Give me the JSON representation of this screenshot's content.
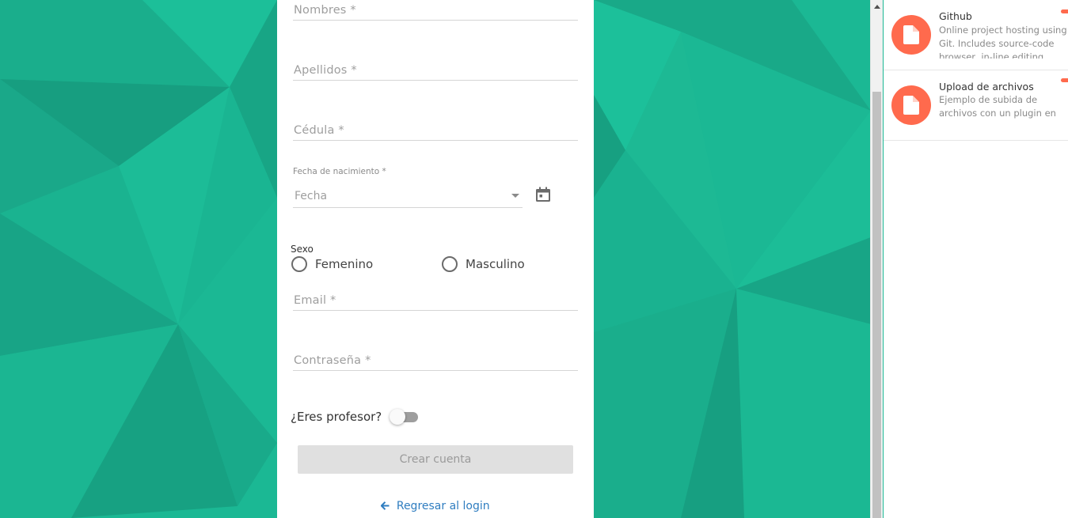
{
  "form": {
    "nombres_placeholder": "Nombres *",
    "apellidos_placeholder": "Apellidos *",
    "cedula_placeholder": "Cédula *",
    "fecha_label": "Fecha de nacimiento *",
    "fecha_placeholder": "Fecha",
    "sexo_label": "Sexo",
    "sexo_options": [
      "Femenino",
      "Masculino"
    ],
    "email_placeholder": "Email *",
    "password_placeholder": "Contraseña *",
    "profesor_label": "¿Eres profesor?",
    "profesor_toggle_on": false,
    "create_button": "Crear cuenta",
    "back_link": "Regresar al login"
  },
  "panel": {
    "items": [
      {
        "title": "Github",
        "description": "Online project hosting using Git. Includes source-code browser, in-line editing"
      },
      {
        "title": "Upload de archivos",
        "description": "Ejemplo de subida de archivos con un plugin en angularjs."
      }
    ]
  },
  "colors": {
    "background": "#1bb894",
    "accent_orange": "#ff6a4d",
    "link_blue": "#2f7dc0",
    "button_disabled": "#e0e0e0"
  },
  "icons": {
    "calendar": "calendar-icon",
    "file": "file-icon",
    "back_arrow": "arrow-left-icon"
  }
}
